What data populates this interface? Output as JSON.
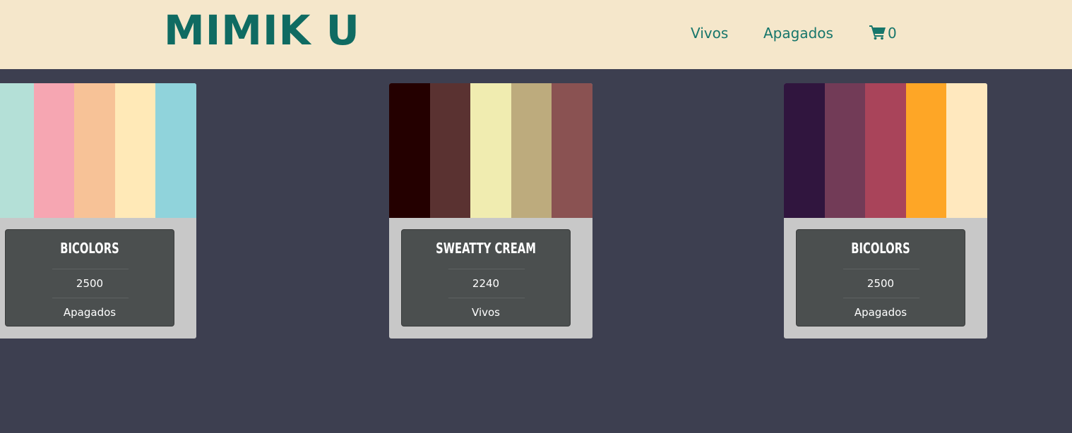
{
  "header": {
    "logo": "MIMIK U",
    "nav": [
      {
        "label": "Vivos"
      },
      {
        "label": "Apagados"
      }
    ],
    "cart": {
      "icon": "cart-icon",
      "count": "0"
    }
  },
  "colors": {
    "header_bg": "#f5e7cb",
    "brand": "#0f6b62",
    "page_bg": "#3d3f50",
    "card_bg": "#c8c8c8",
    "info_bg": "#4b4f4f"
  },
  "products": [
    {
      "name": "BICOLORS",
      "price": "2500",
      "category": "Apagados",
      "swatches": [
        "#b4e0d7",
        "#f6a6b2",
        "#f7c297",
        "#ffe9b7",
        "#90d3db"
      ]
    },
    {
      "name": "SWEATTY CREAM",
      "price": "2240",
      "category": "Vivos",
      "swatches": [
        "#240000",
        "#5a3231",
        "#f0ecb0",
        "#bdab7d",
        "#8a5252"
      ]
    },
    {
      "name": "BICOLORS",
      "price": "2500",
      "category": "Apagados",
      "swatches": [
        "#30153e",
        "#723b57",
        "#a9445a",
        "#fea626",
        "#ffe8be"
      ]
    }
  ]
}
